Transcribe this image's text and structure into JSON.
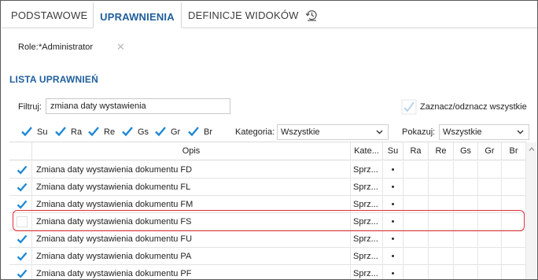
{
  "tabs": [
    {
      "label": "PODSTAWOWE"
    },
    {
      "label": "UPRAWNIENIA"
    },
    {
      "label": "DEFINICJE WIDOKÓW"
    }
  ],
  "role": {
    "label": "Role:",
    "value": "*Administrator"
  },
  "section_title": "LISTA UPRAWNIEŃ",
  "filter": {
    "label": "Filtruj:",
    "value": "zmiana daty wystawienia"
  },
  "toggle_all_label": "Zaznacz/odznacz wszystkie",
  "checkboxes": [
    {
      "label": "Su",
      "checked": true
    },
    {
      "label": "Ra",
      "checked": true
    },
    {
      "label": "Re",
      "checked": true
    },
    {
      "label": "Gs",
      "checked": true
    },
    {
      "label": "Gr",
      "checked": true
    },
    {
      "label": "Br",
      "checked": true
    }
  ],
  "kategoria": {
    "label": "Kategoria:",
    "value": "Wszystkie"
  },
  "pokazuj": {
    "label": "Pokazuj:",
    "value": "Wszystkie"
  },
  "table": {
    "columns": [
      "Opis",
      "Kate...",
      "Su",
      "Ra",
      "Re",
      "Gs",
      "Gr",
      "Br"
    ],
    "rows": [
      {
        "checked": true,
        "opis": "Zmiana daty wystawienia dokumentu FD",
        "kategoria": "Sprz...",
        "su": "•"
      },
      {
        "checked": true,
        "opis": "Zmiana daty wystawienia dokumentu FL",
        "kategoria": "Sprz...",
        "su": "•"
      },
      {
        "checked": true,
        "opis": "Zmiana daty wystawienia dokumentu FM",
        "kategoria": "Sprz...",
        "su": "•"
      },
      {
        "checked": false,
        "opis": "Zmiana daty wystawienia dokumentu FS",
        "kategoria": "Sprz...",
        "su": "•"
      },
      {
        "checked": true,
        "opis": "Zmiana daty wystawienia dokumentu FU",
        "kategoria": "Sprz...",
        "su": "•"
      },
      {
        "checked": true,
        "opis": "Zmiana daty wystawienia dokumentu PA",
        "kategoria": "Sprz...",
        "su": "•"
      },
      {
        "checked": true,
        "opis": "Zmiana daty wystawienia dokumentu PF",
        "kategoria": "Sprz...",
        "su": "•"
      }
    ]
  },
  "colors": {
    "accent": "#1f5f9d",
    "check": "#1e88d6",
    "highlight": "#e0303a"
  },
  "icons": {
    "history": "history-icon",
    "clear": "close-icon",
    "toggle": "checkmark-icon",
    "dropdown": "chevron-down-icon"
  }
}
